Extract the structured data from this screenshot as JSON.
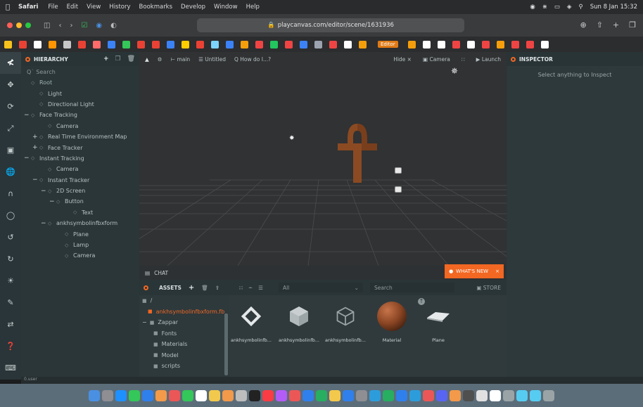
{
  "menubar": {
    "app": "Safari",
    "items": [
      "File",
      "Edit",
      "View",
      "History",
      "Bookmarks",
      "Develop",
      "Window",
      "Help"
    ],
    "clock": "Sun 8 Jan  15:32"
  },
  "browser": {
    "url": "playcanvas.com/editor/scene/1631936",
    "favorites_tab": "Editor"
  },
  "toolbar_left": {
    "branch": "main",
    "scene": "Untitled",
    "help": "How do I...?"
  },
  "toolbar_right": {
    "hide": "Hide",
    "camera": "Camera",
    "launch": "Launch"
  },
  "hierarchy": {
    "title": "HIERARCHY",
    "search_placeholder": "Search",
    "rows": [
      {
        "label": "Root",
        "toggle": "",
        "indent": 0
      },
      {
        "label": "Light",
        "toggle": "",
        "indent": 1
      },
      {
        "label": "Directional Light",
        "toggle": "",
        "indent": 1
      },
      {
        "label": "Face Tracking",
        "toggle": "−",
        "indent": 0
      },
      {
        "label": "Camera",
        "toggle": "",
        "indent": 2
      },
      {
        "label": "Real Time Environment Map",
        "toggle": "+",
        "indent": 1
      },
      {
        "label": "Face Tracker",
        "toggle": "+",
        "indent": 1
      },
      {
        "label": "Instant Tracking",
        "toggle": "−",
        "indent": 0
      },
      {
        "label": "Camera",
        "toggle": "",
        "indent": 2
      },
      {
        "label": "Instant Tracker",
        "toggle": "−",
        "indent": 1
      },
      {
        "label": "2D Screen",
        "toggle": "−",
        "indent": 2
      },
      {
        "label": "Button",
        "toggle": "−",
        "indent": 3
      },
      {
        "label": "Text",
        "toggle": "",
        "indent": 5
      },
      {
        "label": "ankhsymbolinfbxform",
        "toggle": "−",
        "indent": 2
      },
      {
        "label": "Plane",
        "toggle": "",
        "indent": 4
      },
      {
        "label": "Lamp",
        "toggle": "",
        "indent": 4
      },
      {
        "label": "Camera",
        "toggle": "",
        "indent": 4
      }
    ]
  },
  "chat": {
    "label": "CHAT"
  },
  "whats_new": {
    "label": "WHAT'S NEW"
  },
  "assets": {
    "title": "ASSETS",
    "filter": "All",
    "search_placeholder": "Search",
    "store": "STORE",
    "folders": [
      {
        "label": "/",
        "indent": 0,
        "toggle": "",
        "active": false
      },
      {
        "label": "ankhsymbolinfbxform.fb",
        "indent": 1,
        "toggle": "",
        "active": true
      },
      {
        "label": "Zappar",
        "indent": 0,
        "toggle": "−",
        "active": false
      },
      {
        "label": "Fonts",
        "indent": 2,
        "toggle": "",
        "active": false
      },
      {
        "label": "Materials",
        "indent": 2,
        "toggle": "",
        "active": false
      },
      {
        "label": "Model",
        "indent": 2,
        "toggle": "",
        "active": false
      },
      {
        "label": "scripts",
        "indent": 2,
        "toggle": "",
        "active": false
      }
    ],
    "items": [
      {
        "label": "ankhsymbolinfb...",
        "icon": "template-icon"
      },
      {
        "label": "ankhsymbolinfb...",
        "icon": "model-icon"
      },
      {
        "label": "ankhsymbolinfb...",
        "icon": "model-outline-icon"
      },
      {
        "label": "Material",
        "icon": "material-sphere-icon"
      },
      {
        "label": "Plane",
        "icon": "plane-mesh-icon"
      }
    ]
  },
  "inspector": {
    "title": "INSPECTOR",
    "message": "Select anything to Inspect"
  },
  "status": {
    "text": "0.user"
  },
  "colors": {
    "accent": "#f26722",
    "panel": "#2e393c",
    "viewport": "#303233"
  }
}
